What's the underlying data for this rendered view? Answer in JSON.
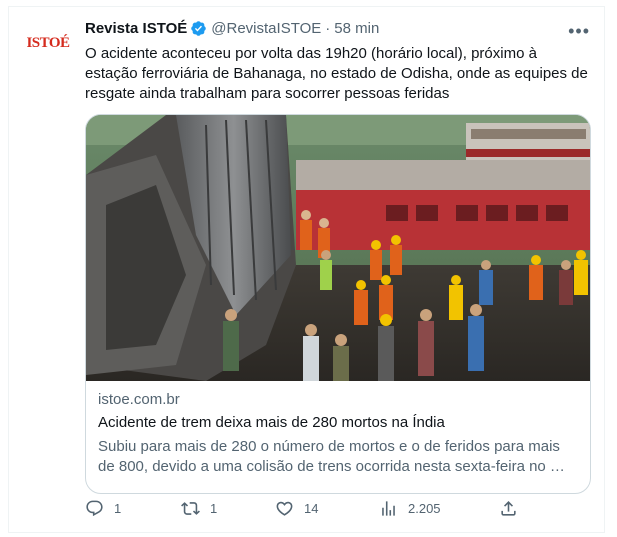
{
  "account": {
    "logo_text": "ISTOÉ",
    "name": "Revista ISTOÉ",
    "handle": "@RevistaISTOE",
    "separator": "·",
    "time": "58 min"
  },
  "tweet_text": "O acidente aconteceu por volta das 19h20 (horário local), próximo à estação ferroviária de Bahanaga, no estado de Odisha, onde as equipes de resgate ainda trabalham para socorrer pessoas feridas",
  "card": {
    "domain": "istoe.com.br",
    "title": "Acidente de trem deixa mais de 280 mortos na Índia",
    "description": "Subiu para mais de 280 o número de mortos e o de feridos para mais de 800, devido a uma colisão de trens ocorrida nesta sexta-feira no …"
  },
  "actions": {
    "replies": "1",
    "retweets": "1",
    "likes": "14",
    "views": "2.205"
  },
  "icons": [
    "verified-icon",
    "more-icon",
    "reply-icon",
    "retweet-icon",
    "like-icon",
    "views-icon",
    "share-icon"
  ],
  "colors": {
    "brand_red": "#d52b1e",
    "verified_blue": "#1d9bf0",
    "text_secondary": "#536471",
    "border": "#cfd9de"
  }
}
